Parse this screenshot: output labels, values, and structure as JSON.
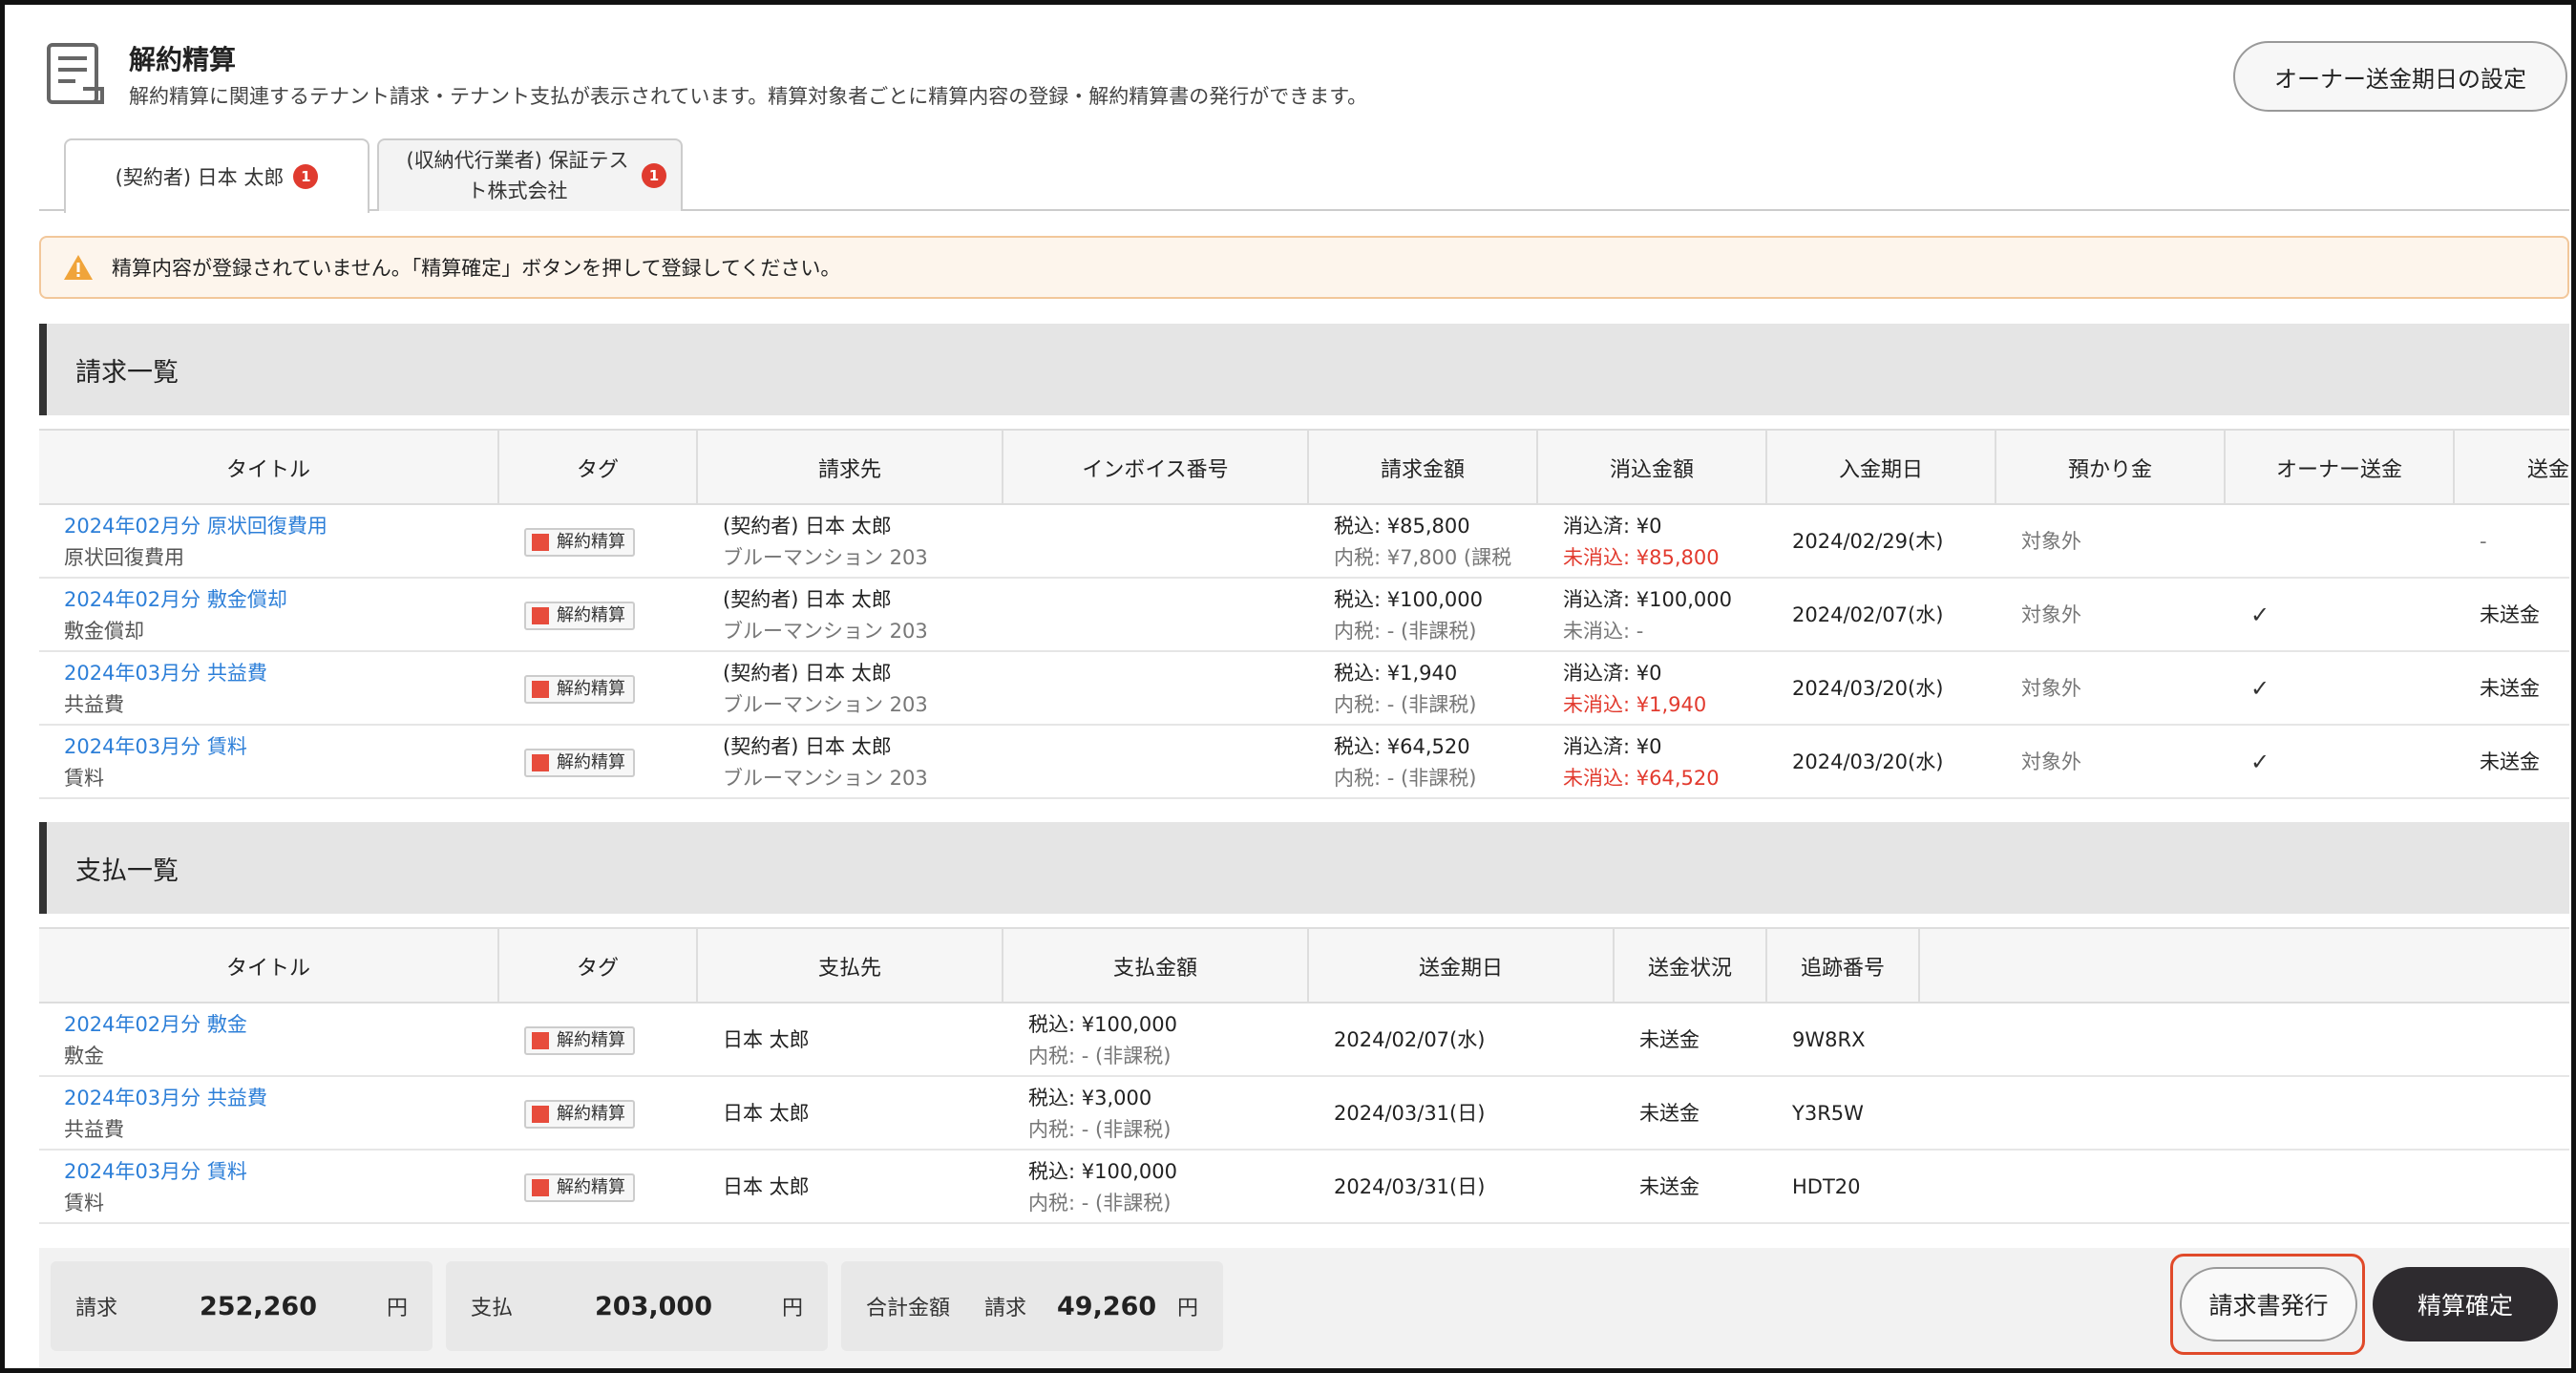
{
  "header": {
    "title": "解約精算",
    "description": "解約精算に関連するテナント請求・テナント支払が表示されています。精算対象者ごとに精算内容の登録・解約精算書の発行ができます。",
    "owner_button": "オーナー送金期日の設定"
  },
  "tabs": [
    {
      "label": "(契約者) 日本 太郎",
      "badge": "1"
    },
    {
      "label": "(収納代行業者) 保証テスト株式会社",
      "line1": "(収納代行業者) 保証テス",
      "line2": "ト株式会社",
      "badge": "1"
    }
  ],
  "alert": {
    "message": "精算内容が登録されていません。「精算確定」ボタンを押して登録してください。"
  },
  "invoices": {
    "section_title": "請求一覧",
    "columns": [
      "タイトル",
      "タグ",
      "請求先",
      "インボイス番号",
      "請求金額",
      "消込金額",
      "入金期日",
      "預かり金",
      "オーナー送金",
      "送金"
    ],
    "rows": [
      {
        "title": "2024年02月分 原状回復費用",
        "subtitle": "原状回復費用",
        "tag": "解約精算",
        "billto": "(契約者) 日本 太郎",
        "billto_sub": "ブルーマンション 203",
        "invoice_no": "",
        "amount": "税込: ¥85,800",
        "amount_sub": "内税: ¥7,800 (課税",
        "cleared": "消込済: ¥0",
        "uncleared": "未消込: ¥85,800",
        "uncleared_red": true,
        "due": "2024/02/29(木)",
        "deposit": "対象外",
        "owner": "",
        "send": "-"
      },
      {
        "title": "2024年02月分 敷金償却",
        "subtitle": "敷金償却",
        "tag": "解約精算",
        "billto": "(契約者) 日本 太郎",
        "billto_sub": "ブルーマンション 203",
        "invoice_no": "",
        "amount": "税込: ¥100,000",
        "amount_sub": "内税: - (非課税)",
        "cleared": "消込済: ¥100,000",
        "uncleared": "未消込: -",
        "uncleared_red": false,
        "due": "2024/02/07(水)",
        "deposit": "対象外",
        "owner": "✓",
        "send": "未送金"
      },
      {
        "title": "2024年03月分 共益費",
        "subtitle": "共益費",
        "tag": "解約精算",
        "billto": "(契約者) 日本 太郎",
        "billto_sub": "ブルーマンション 203",
        "invoice_no": "",
        "amount": "税込: ¥1,940",
        "amount_sub": "内税: - (非課税)",
        "cleared": "消込済: ¥0",
        "uncleared": "未消込: ¥1,940",
        "uncleared_red": true,
        "due": "2024/03/20(水)",
        "deposit": "対象外",
        "owner": "✓",
        "send": "未送金"
      },
      {
        "title": "2024年03月分 賃料",
        "subtitle": "賃料",
        "tag": "解約精算",
        "billto": "(契約者) 日本 太郎",
        "billto_sub": "ブルーマンション 203",
        "invoice_no": "",
        "amount": "税込: ¥64,520",
        "amount_sub": "内税: - (非課税)",
        "cleared": "消込済: ¥0",
        "uncleared": "未消込: ¥64,520",
        "uncleared_red": true,
        "due": "2024/03/20(水)",
        "deposit": "対象外",
        "owner": "✓",
        "send": "未送金"
      }
    ]
  },
  "payments": {
    "section_title": "支払一覧",
    "columns": [
      "タイトル",
      "タグ",
      "支払先",
      "支払金額",
      "送金期日",
      "送金状況",
      "追跡番号"
    ],
    "rows": [
      {
        "title": "2024年02月分 敷金",
        "subtitle": "敷金",
        "tag": "解約精算",
        "payee": "日本 太郎",
        "amount": "税込: ¥100,000",
        "amount_sub": "内税: - (非課税)",
        "due": "2024/02/07(水)",
        "status": "未送金",
        "tracking": "9W8RX"
      },
      {
        "title": "2024年03月分 共益費",
        "subtitle": "共益費",
        "tag": "解約精算",
        "payee": "日本 太郎",
        "amount": "税込: ¥3,000",
        "amount_sub": "内税: - (非課税)",
        "due": "2024/03/31(日)",
        "status": "未送金",
        "tracking": "Y3R5W"
      },
      {
        "title": "2024年03月分 賃料",
        "subtitle": "賃料",
        "tag": "解約精算",
        "payee": "日本 太郎",
        "amount": "税込: ¥100,000",
        "amount_sub": "内税: - (非課税)",
        "due": "2024/03/31(日)",
        "status": "未送金",
        "tracking": "HDT20"
      }
    ]
  },
  "footer": {
    "billing_label": "請求",
    "billing_value": "252,260",
    "billing_unit": "円",
    "payment_label": "支払",
    "payment_value": "203,000",
    "payment_unit": "円",
    "total_label": "合計金額",
    "total_kind": "請求",
    "total_value": "49,260",
    "total_unit": "円",
    "invoice_button": "請求書発行",
    "confirm_button": "精算確定"
  },
  "colors": {
    "link": "#2d7fd8",
    "red": "#e23a2e",
    "tag": "#e74c3c",
    "dark_button": "#2e2b2f"
  },
  "icons": {
    "page": "document-icon",
    "alert": "warning-icon",
    "check": "checkmark-icon"
  }
}
